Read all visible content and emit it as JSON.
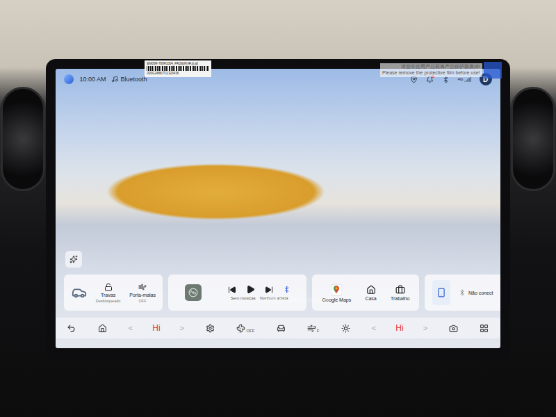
{
  "sticker": {
    "model": "EM06R-780R1004_PAD临时屏总成",
    "serial": "030G2488JT11320436"
  },
  "film_notice": [
    "请您在使用产品前将产品保护膜撕掉!",
    "Please remove the protective film before use!"
  ],
  "status_bar": {
    "time": "10:00 AM",
    "source": "Bluetooth",
    "network": "4G",
    "avatar": "D",
    "notification_dot": true
  },
  "vehicle_card": {
    "items": [
      {
        "label": "Travas",
        "value": "Desbloqueado"
      },
      {
        "label": "Porta-malas",
        "value": "OFF"
      }
    ]
  },
  "media_card": {
    "title": "Sem músicas",
    "artist": "Nenhum artista",
    "playing": false
  },
  "nav_card": {
    "items": [
      {
        "label": "Google Maps"
      },
      {
        "label": "Casa"
      },
      {
        "label": "Trabalho"
      }
    ]
  },
  "phone_card": {
    "status": "Não conect"
  },
  "dock": {
    "left_temp": {
      "prev": "<",
      "value": "Hi",
      "next": ">"
    },
    "fan": {
      "label": "OFF"
    },
    "defrost": {
      "label": "F"
    },
    "right_temp": {
      "prev": "<",
      "value": "Hi",
      "next": ">"
    }
  },
  "watermark": "carrosnaserra.com.br"
}
